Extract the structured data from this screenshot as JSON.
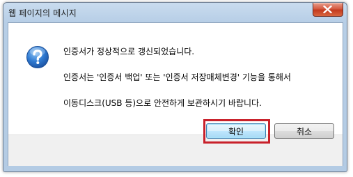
{
  "window": {
    "title": "웹 페이지의 메시지"
  },
  "message": {
    "line1": "인증서가 정상적으로 갱신되었습니다.",
    "line2": "인증서는 '인증서 백업' 또는 '인증서 저장매체변경' 기능을 통해서",
    "line3": "이동디스크(USB 등)으로 안전하게 보관하시기 바랍니다."
  },
  "buttons": {
    "ok_label": "확인",
    "cancel_label": "취소"
  },
  "icons": {
    "dialog_icon": "info-question-icon",
    "close_icon": "close-icon"
  },
  "colors": {
    "highlight_border": "#c8202a",
    "close_button": "#c33a1e"
  }
}
